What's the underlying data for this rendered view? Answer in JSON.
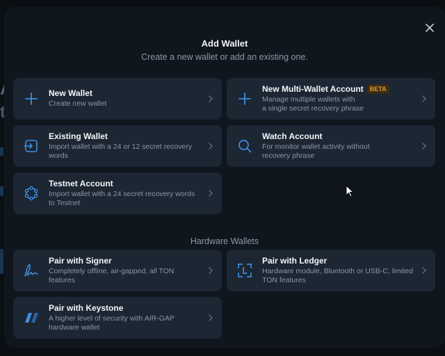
{
  "background_app": {
    "glyph_a": "A",
    "glyph_t": "t"
  },
  "modal": {
    "title": "Add Wallet",
    "subtitle": "Create a new wallet or add an existing one.",
    "close_icon": "close-icon",
    "accent_color": "#3d8fe0",
    "options": [
      {
        "name": "New Wallet",
        "desc": "Create new wallet",
        "icon": "plus-icon"
      },
      {
        "name": "New Multi-Wallet Account",
        "badge": "BETA",
        "desc": "Manage multiple wallets with\na single secret recovery phrase",
        "icon": "plus-icon"
      },
      {
        "name": "Existing Wallet",
        "desc": "Import wallet with a 24 or 12 secret recovery\nwords",
        "icon": "import-icon"
      },
      {
        "name": "Watch Account",
        "desc": "For monitor wallet activity without\nrecovery phrase",
        "icon": "search-icon"
      },
      {
        "name": "Testnet Account",
        "desc": "Import wallet with a 24 secret recovery words\nto Testnet",
        "icon": "testnet-icon"
      }
    ],
    "hardware_section_label": "Hardware Wallets",
    "hardware": [
      {
        "name": "Pair with Signer",
        "desc": "Completely offline, air-gapped, all TON\nfeatures",
        "icon": "signer-icon"
      },
      {
        "name": "Pair with Ledger",
        "desc": "Hardware module, Bluetooth or USB-C, limited\nTON features",
        "icon": "ledger-icon"
      },
      {
        "name": "Pair with Keystone",
        "desc": "A higher level of security with AIR-GAP\nhardware wallet",
        "icon": "keystone-icon"
      }
    ]
  }
}
